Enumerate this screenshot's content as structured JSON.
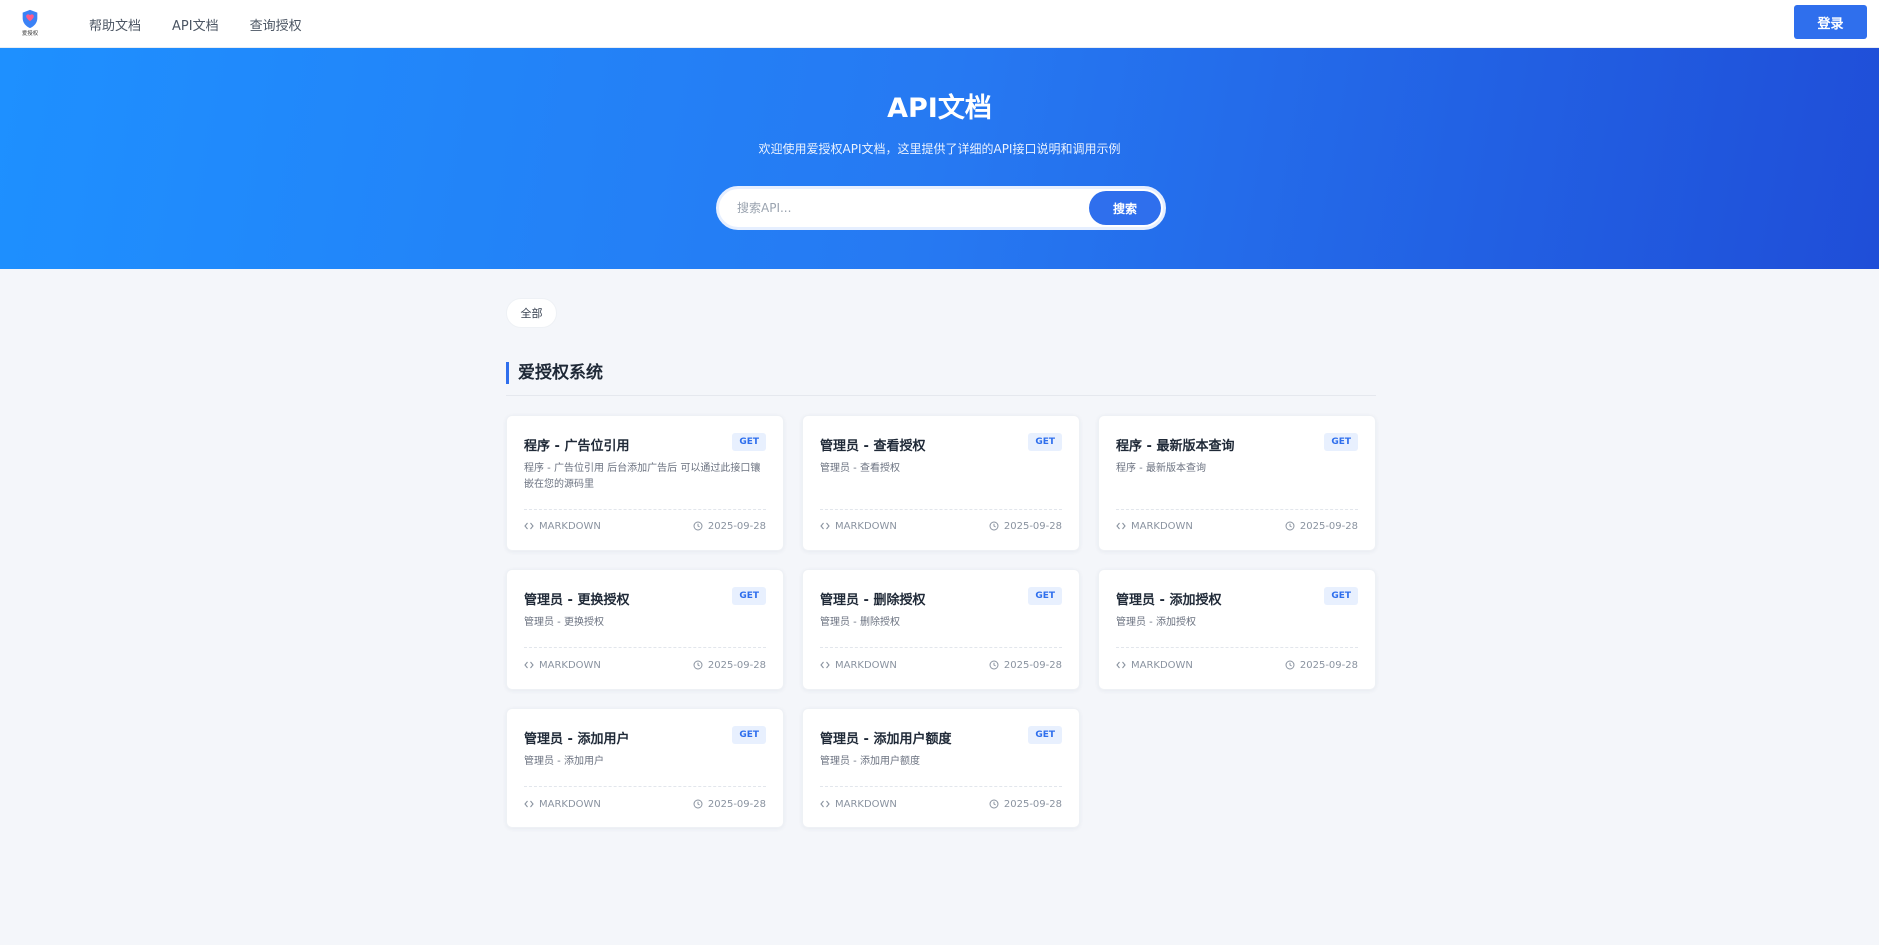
{
  "header": {
    "logo_text": "爱授权",
    "nav": [
      "帮助文档",
      "API文档",
      "查询授权"
    ],
    "login_label": "登录"
  },
  "hero": {
    "title": "API文档",
    "subtitle": "欢迎使用爱授权API文档，这里提供了详细的API接口说明和调用示例",
    "search_placeholder": "搜索API...",
    "search_label": "搜索"
  },
  "filters": [
    "全部"
  ],
  "section": {
    "title": "爱授权系统"
  },
  "cards": [
    {
      "title": "程序 - 广告位引用",
      "method": "GET",
      "desc": "程序 - 广告位引用 后台添加广告后 可以通过此接口镶嵌在您的源码里",
      "format": "MARKDOWN",
      "date": "2025-09-28"
    },
    {
      "title": "管理员 - 查看授权",
      "method": "GET",
      "desc": "管理员 - 查看授权",
      "format": "MARKDOWN",
      "date": "2025-09-28"
    },
    {
      "title": "程序 - 最新版本查询",
      "method": "GET",
      "desc": "程序 - 最新版本查询",
      "format": "MARKDOWN",
      "date": "2025-09-28"
    },
    {
      "title": "管理员 - 更换授权",
      "method": "GET",
      "desc": "管理员 - 更换授权",
      "format": "MARKDOWN",
      "date": "2025-09-28"
    },
    {
      "title": "管理员 - 删除授权",
      "method": "GET",
      "desc": "管理员 - 删除授权",
      "format": "MARKDOWN",
      "date": "2025-09-28"
    },
    {
      "title": "管理员 - 添加授权",
      "method": "GET",
      "desc": "管理员 - 添加授权",
      "format": "MARKDOWN",
      "date": "2025-09-28"
    },
    {
      "title": "管理员 - 添加用户",
      "method": "GET",
      "desc": "管理员 - 添加用户",
      "format": "MARKDOWN",
      "date": "2025-09-28"
    },
    {
      "title": "管理员 - 添加用户额度",
      "method": "GET",
      "desc": "管理员 - 添加用户额度",
      "format": "MARKDOWN",
      "date": "2025-09-28"
    }
  ],
  "colors": {
    "accent": "#2f6fed",
    "hero_start": "#1e90ff",
    "hero_end": "#1f4ed8",
    "background": "#f4f6fa"
  },
  "icons": {
    "format": "code-icon",
    "date": "clock-icon",
    "logo": "shield-heart-icon"
  }
}
